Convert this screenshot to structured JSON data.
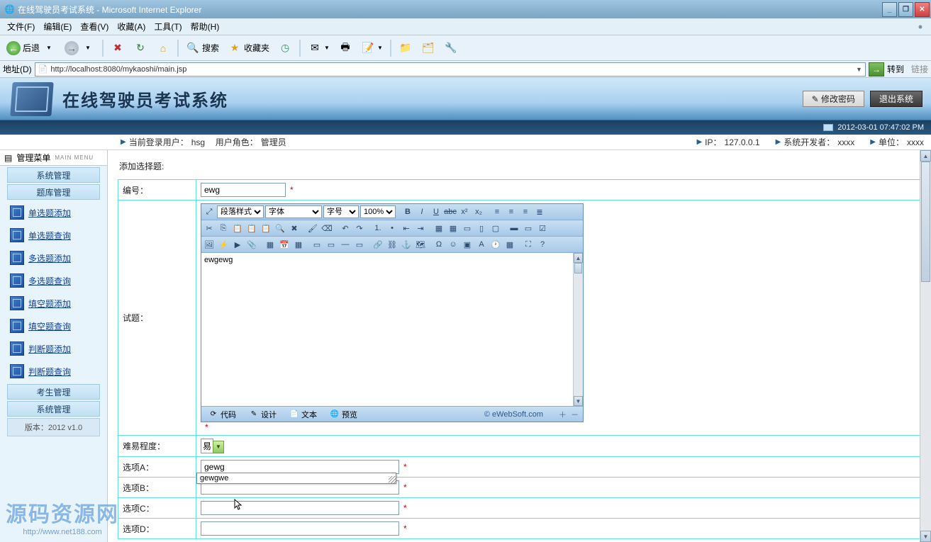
{
  "window": {
    "title": "在线驾驶员考试系统 - Microsoft Internet Explorer"
  },
  "menu": {
    "file": "文件(F)",
    "edit": "编辑(E)",
    "view": "查看(V)",
    "fav": "收藏(A)",
    "tools": "工具(T)",
    "help": "帮助(H)"
  },
  "toolbar": {
    "back": "后退",
    "search": "搜索",
    "fav": "收藏夹"
  },
  "address": {
    "label": "地址(D)",
    "url": "http://localhost:8080/mykaoshi/main.jsp",
    "go": "转到",
    "links": "链接"
  },
  "app": {
    "title": "在线驾驶员考试系统",
    "change_pwd": "修改密码",
    "logout": "退出系统",
    "datetime": "2012-03-01 07:47:02 PM"
  },
  "secbar": {
    "user_label": "当前登录用户：",
    "user": "hsg",
    "role_label": "用户角色：",
    "role": "管理员",
    "ip_label": "IP：",
    "ip": "127.0.0.1",
    "dev_label": "系统开发者：",
    "dev": "xxxx",
    "unit_label": "单位：",
    "unit": "xxxx"
  },
  "sidebar": {
    "title": "管理菜单",
    "title_en": "MAIN MENU",
    "cat1": "系统管理",
    "cat2": "题库管理",
    "links": [
      "单选题添加",
      "单选题查询",
      "多选题添加",
      "多选题查询",
      "填空题添加",
      "填空题查询",
      "判断题添加",
      "判断题查询"
    ],
    "cat3": "考生管理",
    "cat4": "系统管理",
    "version": "版本：2012 v1.0"
  },
  "page": {
    "title": "添加选择题:"
  },
  "form": {
    "id_label": "编号：",
    "id_value": "ewg",
    "question_label": "试题：",
    "difficulty_label": "难易程度：",
    "difficulty_value": "易",
    "optA_label": "选项A：",
    "optA_value": "gewg",
    "optB_label": "选项B：",
    "optB_value": "",
    "optC_label": "选项C：",
    "optC_value": "",
    "optD_label": "选项D：",
    "optD_value": "",
    "autocomplete": "gewgwe",
    "star": "*"
  },
  "editor": {
    "para": "段落样式",
    "font": "字体",
    "size": "字号",
    "zoom": "100%",
    "body": "ewgewg",
    "tab_code": "代码",
    "tab_design": "设计",
    "tab_text": "文本",
    "tab_preview": "预览",
    "copy": "© eWebSoft.com"
  },
  "watermark": {
    "text": "源码资源网",
    "url": "http://www.net188.com"
  }
}
